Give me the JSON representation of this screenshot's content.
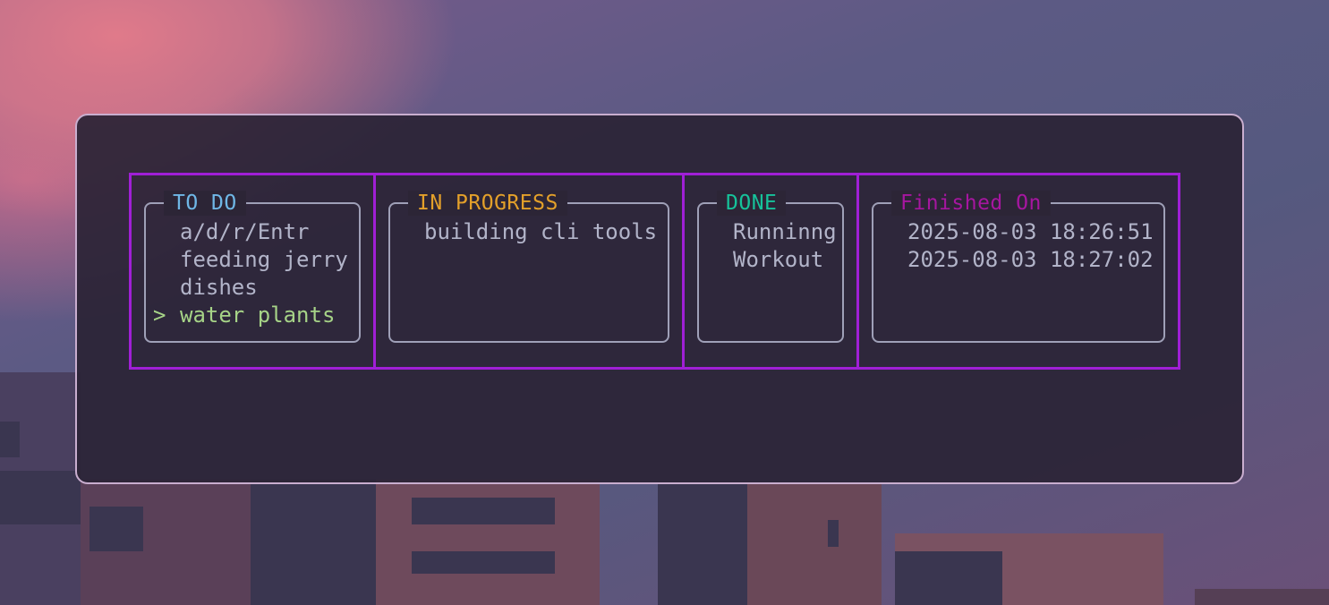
{
  "board": {
    "columns": [
      {
        "title": "TO DO",
        "items": [
          {
            "label": "a/d/r/Entr",
            "cursor": ""
          },
          {
            "label": "feeding jerry",
            "cursor": ""
          },
          {
            "label": "dishes",
            "cursor": ""
          },
          {
            "label": "water plants",
            "cursor": ">"
          }
        ]
      },
      {
        "title": "IN PROGRESS",
        "items": [
          {
            "label": "building cli tools",
            "cursor": ""
          }
        ]
      },
      {
        "title": "DONE",
        "items": [
          {
            "label": "Runninng",
            "cursor": ""
          },
          {
            "label": "Workout",
            "cursor": ""
          }
        ]
      },
      {
        "title": "Finished On",
        "items": [
          {
            "label": "2025-08-03 18:26:51",
            "cursor": ""
          },
          {
            "label": "2025-08-03 18:27:02",
            "cursor": ""
          }
        ]
      }
    ]
  },
  "colors": {
    "todo_title": "#6fb7e6",
    "in_progress_title": "#e3a02a",
    "done_title": "#16c29a",
    "finished_title": "#a616a0",
    "selected_item": "#a6d387",
    "board_border": "#a01fd6"
  }
}
